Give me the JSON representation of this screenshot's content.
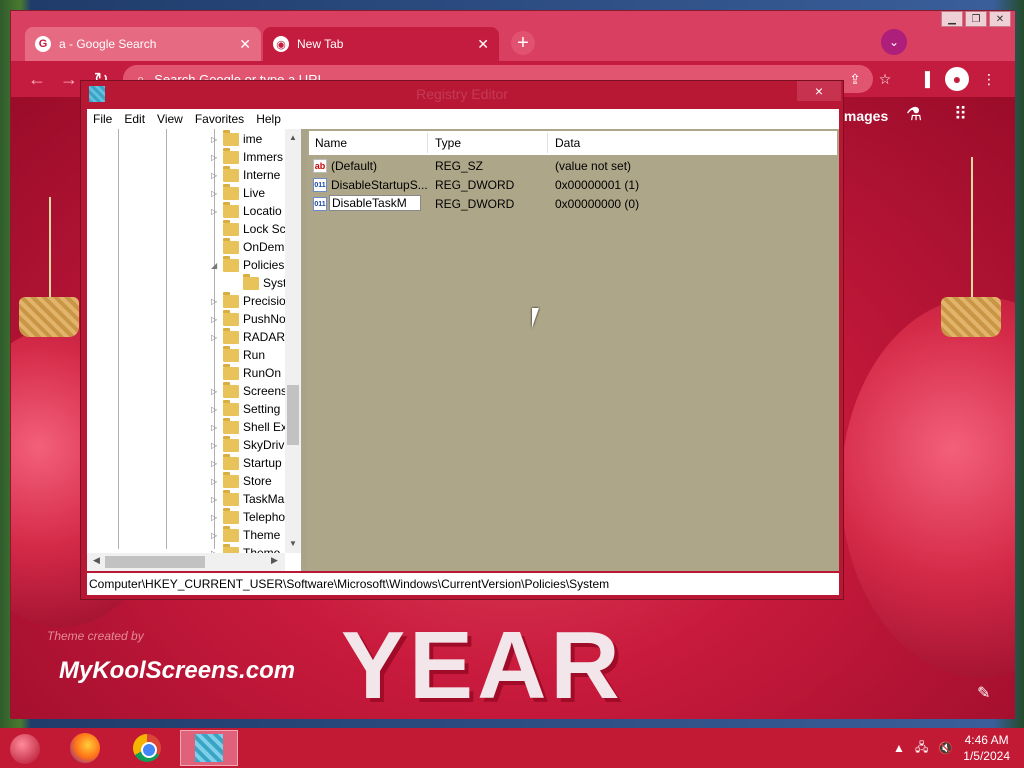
{
  "browser": {
    "tabs": [
      {
        "label": "a - Google Search",
        "favicon": "G"
      },
      {
        "label": "New Tab",
        "favicon": "chrome"
      }
    ],
    "omnibox_placeholder": "Search Google or type a URL",
    "images_link": "Images",
    "window_buttons": [
      "minimize",
      "maximize",
      "close"
    ]
  },
  "newtab": {
    "brand": "MyKoolScreens.com",
    "creator_text": "Theme created by",
    "year_text": "YEAR"
  },
  "regedit": {
    "title": "Registry Editor",
    "close_label": "×",
    "menu": [
      "File",
      "Edit",
      "View",
      "Favorites",
      "Help"
    ],
    "tree": [
      {
        "label": "ime",
        "arrow": "▷"
      },
      {
        "label": "Immers",
        "arrow": "▷"
      },
      {
        "label": "Interne",
        "arrow": "▷"
      },
      {
        "label": "Live",
        "arrow": "▷"
      },
      {
        "label": "Locatio",
        "arrow": "▷"
      },
      {
        "label": "Lock Sc",
        "arrow": ""
      },
      {
        "label": "OnDem",
        "arrow": ""
      },
      {
        "label": "Policies",
        "arrow": "◢"
      },
      {
        "label": "Syst",
        "arrow": ""
      },
      {
        "label": "Precisio",
        "arrow": "▷"
      },
      {
        "label": "PushNo",
        "arrow": "▷"
      },
      {
        "label": "RADAR",
        "arrow": "▷"
      },
      {
        "label": "Run",
        "arrow": ""
      },
      {
        "label": "RunOn",
        "arrow": ""
      },
      {
        "label": "Screens",
        "arrow": "▷"
      },
      {
        "label": "Setting",
        "arrow": "▷"
      },
      {
        "label": "Shell Ex",
        "arrow": "▷"
      },
      {
        "label": "SkyDriv",
        "arrow": "▷"
      },
      {
        "label": "Startup",
        "arrow": "▷"
      },
      {
        "label": "Store",
        "arrow": "▷"
      },
      {
        "label": "TaskMa",
        "arrow": "▷"
      },
      {
        "label": "Telepho",
        "arrow": "▷"
      },
      {
        "label": "Theme",
        "arrow": "▷"
      },
      {
        "label": "Theme",
        "arrow": "▷"
      }
    ],
    "columns": [
      "Name",
      "Type",
      "Data"
    ],
    "values": [
      {
        "name": "(Default)",
        "type": "REG_SZ",
        "data": "(value not set)",
        "icon": "string-value-icon"
      },
      {
        "name": "DisableStartupS...",
        "type": "REG_DWORD",
        "data": "0x00000001 (1)",
        "icon": "dword-value-icon"
      },
      {
        "name": "DisableTaskM",
        "type": "REG_DWORD",
        "data": "0x00000000 (0)",
        "icon": "dword-value-icon"
      }
    ],
    "status_path": "Computer\\HKEY_CURRENT_USER\\Software\\Microsoft\\Windows\\CurrentVersion\\Policies\\System"
  },
  "taskbar": {
    "time": "4:46 AM",
    "date": "1/5/2024",
    "apps": [
      "Firefox",
      "Google Chrome",
      "Registry Editor"
    ]
  }
}
